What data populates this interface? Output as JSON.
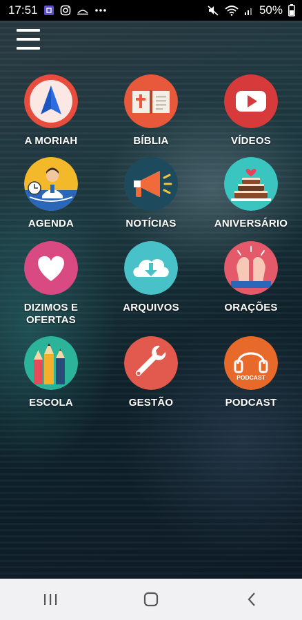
{
  "status_bar": {
    "time": "17:51",
    "battery": "50%",
    "icons": [
      "app-notification-icon",
      "instagram-icon",
      "cast-icon",
      "more-dots-icon",
      "mute-icon",
      "wifi-icon",
      "signal-icon",
      "battery-icon"
    ]
  },
  "menu": {
    "icon": "hamburger-menu-icon"
  },
  "tiles": [
    {
      "label": "A MORIAH",
      "icon": "navigation-arrow-icon",
      "color": "#e74c3c"
    },
    {
      "label": "BÍBLIA",
      "icon": "bible-icon",
      "color": "#e8583a"
    },
    {
      "label": "VÍDEOS",
      "icon": "youtube-icon",
      "color": "#d63a3a"
    },
    {
      "label": "AGENDA",
      "icon": "agenda-person-icon",
      "color": "#f3b92a"
    },
    {
      "label": "NOTÍCIAS",
      "icon": "megaphone-icon",
      "color": "#1d4a5c"
    },
    {
      "label": "ANIVERSÁRIO",
      "icon": "cake-icon",
      "color": "#3ac5c0"
    },
    {
      "label": "DIZIMOS E",
      "label2": "OFERTAS",
      "icon": "heart-icon",
      "color": "#d94a82"
    },
    {
      "label": "ARQUIVOS",
      "icon": "cloud-download-icon",
      "color": "#49c1c8"
    },
    {
      "label": "ORAÇÕES",
      "icon": "praying-hands-icon",
      "color": "#e55a6a"
    },
    {
      "label": "ESCOLA",
      "icon": "pencils-icon",
      "color": "#2bb49a"
    },
    {
      "label": "GESTÃO",
      "icon": "wrench-icon",
      "color": "#e25a4e"
    },
    {
      "label": "PODCAST",
      "icon": "headphones-icon",
      "color": "#e76a2a",
      "inner_text": "PODCAST"
    }
  ],
  "nav": {
    "recents": "recents-icon",
    "home": "home-icon",
    "back": "back-icon"
  }
}
